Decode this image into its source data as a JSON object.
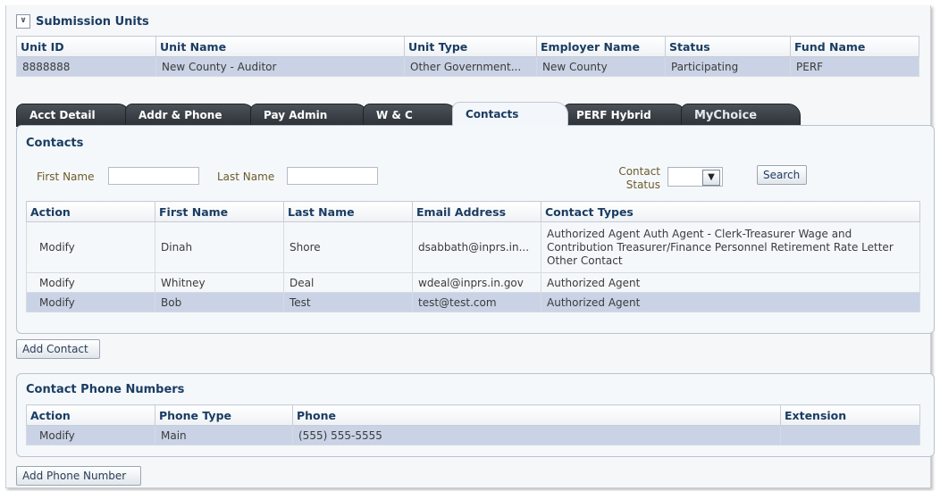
{
  "submission_units": {
    "title": "Submission Units",
    "headers": [
      "Unit ID",
      "Unit Name",
      "Unit Type",
      "Employer Name",
      "Status",
      "Fund Name"
    ],
    "row": [
      "8888888",
      "New County - Auditor",
      "Other Government...",
      "New County",
      "Participating",
      "PERF"
    ]
  },
  "tabs": [
    "Acct Detail",
    "Addr & Phone",
    "Pay Admin",
    "W & C",
    "Contacts",
    "PERF Hybrid",
    "MyChoice"
  ],
  "active_tab": "Contacts",
  "contacts": {
    "title": "Contacts",
    "first_name_label": "First Name",
    "first_name_value": "",
    "last_name_label": "Last Name",
    "last_name_value": "",
    "contact_status_label_1": "Contact",
    "contact_status_label_2": "Status",
    "contact_status_value": "",
    "search_label": "Search",
    "headers": [
      "Action",
      "First Name",
      "Last Name",
      "Email Address",
      "Contact Types"
    ],
    "rows": [
      {
        "action": "Modify",
        "first": "Dinah",
        "last": "Shore",
        "email": "dsabbath@inprs.in...",
        "types": "Authorized Agent Auth Agent - Clerk-Treasurer Wage and Contribution Treasurer/Finance Personnel Retirement Rate Letter Other Contact"
      },
      {
        "action": "Modify",
        "first": "Whitney",
        "last": "Deal",
        "email": "wdeal@inprs.in.gov",
        "types": "Authorized Agent"
      },
      {
        "action": "Modify",
        "first": "Bob",
        "last": "Test",
        "email": "test@test.com",
        "types": "Authorized Agent"
      }
    ],
    "add_label": "Add Contact"
  },
  "phones": {
    "title": "Contact Phone Numbers",
    "headers": [
      "Action",
      "Phone Type",
      "Phone",
      "Extension"
    ],
    "rows": [
      {
        "action": "Modify",
        "type": "Main",
        "phone": "(555) 555-5555",
        "extension": ""
      }
    ],
    "add_label": "Add Phone Number"
  },
  "colors": {
    "header_text": "#1a3d62",
    "selected_row": "#c9d3e5",
    "tab_dark": "#2d3237",
    "link": "#2a4f8b"
  }
}
